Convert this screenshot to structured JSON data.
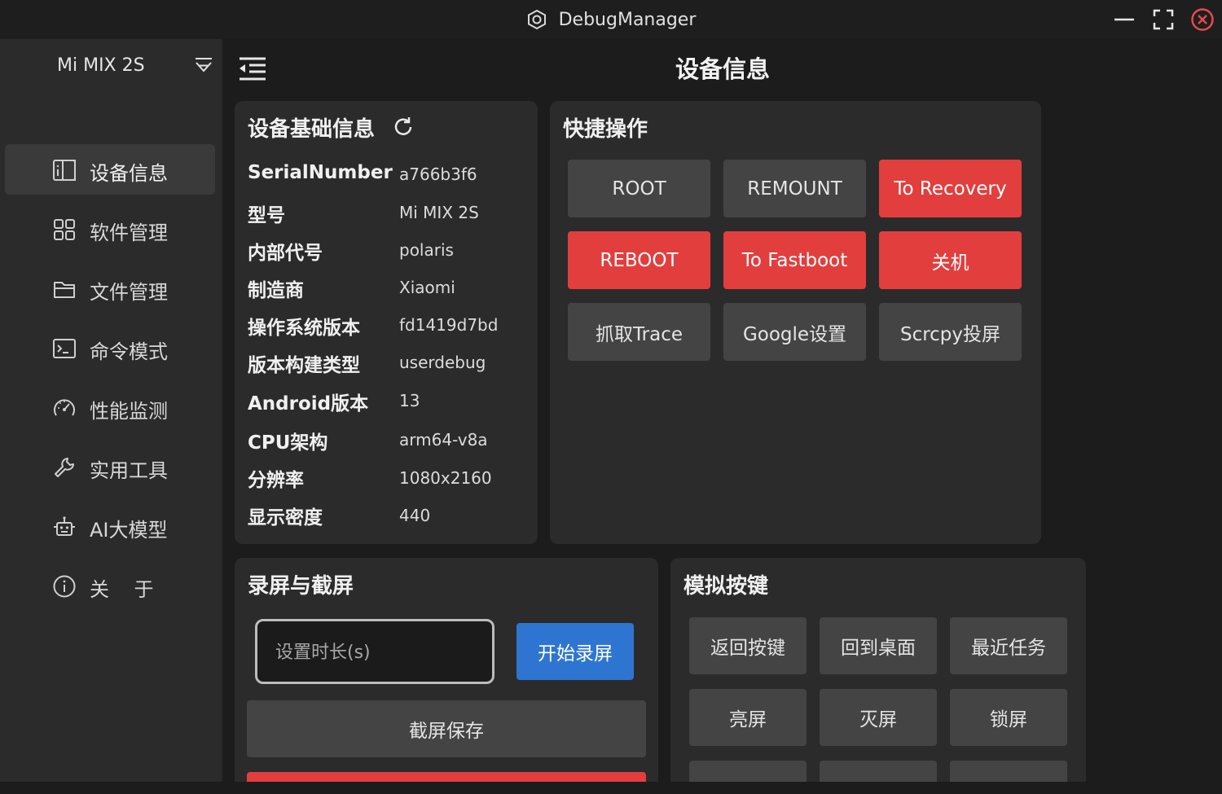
{
  "window": {
    "title": "DebugManager"
  },
  "sidebar": {
    "device_name": "Mi MIX 2S",
    "items": [
      {
        "label": "设备信息",
        "icon": "device-info-icon",
        "active": true
      },
      {
        "label": "软件管理",
        "icon": "apps-grid-icon",
        "active": false
      },
      {
        "label": "文件管理",
        "icon": "folder-icon",
        "active": false
      },
      {
        "label": "命令模式",
        "icon": "terminal-icon",
        "active": false
      },
      {
        "label": "性能监测",
        "icon": "gauge-icon",
        "active": false
      },
      {
        "label": "实用工具",
        "icon": "wrench-icon",
        "active": false
      },
      {
        "label": "AI大模型",
        "icon": "robot-icon",
        "active": false
      },
      {
        "label": "关    于",
        "icon": "info-icon",
        "active": false
      }
    ]
  },
  "main": {
    "title": "设备信息"
  },
  "device_info": {
    "title": "设备基础信息",
    "rows": [
      {
        "key": "SerialNumber",
        "value": "a766b3f6"
      },
      {
        "key": "型号",
        "value": "Mi MIX 2S"
      },
      {
        "key": "内部代号",
        "value": "polaris"
      },
      {
        "key": "制造商",
        "value": "Xiaomi"
      },
      {
        "key": "操作系统版本",
        "value": "fd1419d7bd"
      },
      {
        "key": "版本构建类型",
        "value": "userdebug"
      },
      {
        "key": "Android版本",
        "value": "13"
      },
      {
        "key": "CPU架构",
        "value": "arm64-v8a"
      },
      {
        "key": "分辨率",
        "value": "1080x2160"
      },
      {
        "key": "显示密度",
        "value": "440"
      }
    ]
  },
  "quick_actions": {
    "title": "快捷操作",
    "buttons": [
      {
        "label": "ROOT",
        "style": "gray"
      },
      {
        "label": "REMOUNT",
        "style": "gray"
      },
      {
        "label": "To Recovery",
        "style": "red"
      },
      {
        "label": "REBOOT",
        "style": "red"
      },
      {
        "label": "To Fastboot",
        "style": "red"
      },
      {
        "label": "关机",
        "style": "red"
      },
      {
        "label": "抓取Trace",
        "style": "gray"
      },
      {
        "label": "Google设置",
        "style": "gray"
      },
      {
        "label": "Scrcpy投屏",
        "style": "gray"
      }
    ]
  },
  "record": {
    "title": "录屏与截屏",
    "duration_placeholder": "设置时长(s)",
    "duration_value": "",
    "start_label": "开始录屏",
    "screenshot_label": "截屏保存"
  },
  "keys": {
    "title": "模拟按键",
    "buttons": [
      "返回按键",
      "回到桌面",
      "最近任务",
      "亮屏",
      "灭屏",
      "锁屏"
    ]
  },
  "colors": {
    "accent_red": "#e23e3e",
    "accent_blue": "#2e75d1",
    "card_bg": "#2b2b2b",
    "button_gray": "#444444",
    "close_icon": "#e24b4b"
  }
}
